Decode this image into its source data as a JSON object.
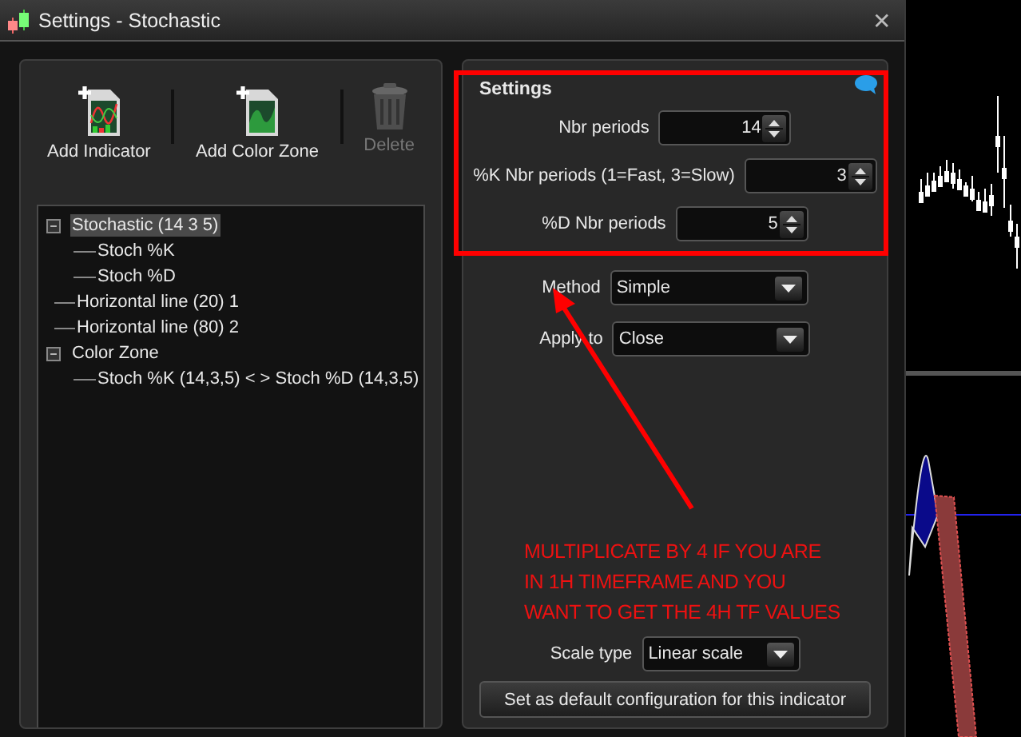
{
  "window": {
    "title": "Settings - Stochastic",
    "close": "✕"
  },
  "toolbar": [
    {
      "label": "Add Indicator",
      "kind": "indicator",
      "disabled": false
    },
    {
      "label": "Add Color Zone",
      "kind": "zone",
      "disabled": false
    },
    {
      "label": "Delete",
      "kind": "delete",
      "disabled": true
    }
  ],
  "tree": [
    {
      "label": "Stochastic (14 3 5)",
      "selected": true,
      "expanded": true,
      "children": [
        {
          "label": "Stoch %K",
          "selected": false
        },
        {
          "label": "Stoch %D",
          "selected": false
        }
      ]
    },
    {
      "label": "Horizontal line (20) 1",
      "selected": false
    },
    {
      "label": "Horizontal line (80) 2",
      "selected": false
    },
    {
      "label": "Color Zone",
      "selected": false,
      "expanded": true,
      "children": [
        {
          "label": "Stoch %K (14,3,5) < > Stoch %D (14,3,5)",
          "selected": false
        }
      ]
    }
  ],
  "settings": {
    "title": "Settings",
    "fields": [
      {
        "label": "Nbr periods",
        "value": "14",
        "kind": "spin"
      },
      {
        "label": "%K Nbr periods (1=Fast, 3=Slow)",
        "value": "3",
        "kind": "spin"
      },
      {
        "label": "%D Nbr periods",
        "value": "5",
        "kind": "spin"
      },
      {
        "label": "Method",
        "value": "Simple",
        "kind": "select"
      },
      {
        "label": "Apply to",
        "value": "Close",
        "kind": "select"
      }
    ],
    "scale": {
      "label": "Scale type",
      "value": "Linear scale"
    },
    "default_button": "Set as default configuration for this indicator"
  },
  "annotation": {
    "lines": [
      "MULTIPLICATE BY 4 IF YOU ARE",
      "IN 1H TIMEFRAME AND YOU",
      "WANT TO GET THE 4H TF VALUES"
    ]
  }
}
